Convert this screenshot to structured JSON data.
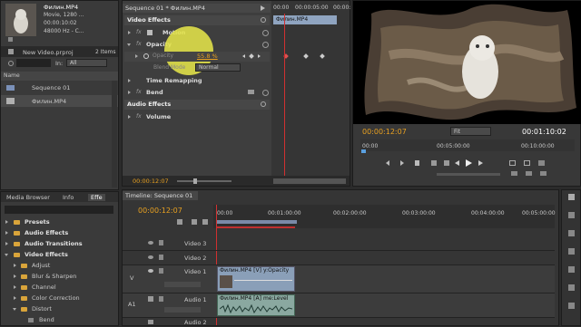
{
  "project": {
    "clip_name": "Филин.MP4",
    "clip_line2": "Movie, 1280 ...",
    "clip_line3": "00:00:10:02",
    "clip_line4": "48000 Hz - C...",
    "project_file": "New Video.prproj",
    "items_count": "2 Items",
    "in_label": "In:",
    "in_value": "All",
    "name_col": "Name",
    "items": [
      {
        "label": "Sequence 01"
      },
      {
        "label": "Филин.MP4"
      }
    ]
  },
  "effect_controls": {
    "tab_sequence": "Sequence 01 * Филин.MP4",
    "timecode_top": "00:00",
    "timecode_mid": "00:00:05:00",
    "timecode_right": "00:00:",
    "clip_label": "Филин.MP4",
    "video_effects": "Video Effects",
    "motion": "Motion",
    "opacity": "Opacity",
    "opacity_param": "Opacity",
    "opacity_value": "55.8 %",
    "blend_mode_label": "Blend Mode",
    "blend_mode_value": "Normal",
    "time_remapping": "Time Remapping",
    "bend": "Bend",
    "audio_effects": "Audio Effects",
    "volume": "Volume",
    "current_time": "00:00:12:07"
  },
  "program": {
    "current_time": "00:00:12:07",
    "fit": "Fit",
    "duration": "00:01:10:02",
    "ruler": [
      "00:00",
      "00:05:00:00",
      "00:10:00:00"
    ]
  },
  "effects_panel": {
    "tabs": [
      "Media Browser",
      "Info",
      "Effe"
    ],
    "items": [
      {
        "label": "Presets",
        "level": 0,
        "open": false
      },
      {
        "label": "Audio Effects",
        "level": 0,
        "open": false
      },
      {
        "label": "Audio Transitions",
        "level": 0,
        "open": false
      },
      {
        "label": "Video Effects",
        "level": 0,
        "open": true
      },
      {
        "label": "Adjust",
        "level": 1,
        "open": false
      },
      {
        "label": "Blur & Sharpen",
        "level": 1,
        "open": false
      },
      {
        "label": "Channel",
        "level": 1,
        "open": false
      },
      {
        "label": "Color Correction",
        "level": 1,
        "open": false
      },
      {
        "label": "Distort",
        "level": 1,
        "open": true
      },
      {
        "label": "Bend",
        "level": 2,
        "open": false
      }
    ]
  },
  "timeline": {
    "tab": "Timeline: Sequence 01",
    "current_time": "00:00:12:07",
    "ruler": [
      "00:00",
      "00:01:00:00",
      "00:02:00:00",
      "00:03:00:00",
      "00:04:00:00",
      "00:05:00:00"
    ],
    "tracks": [
      {
        "name": "Video 3"
      },
      {
        "name": "Video 2"
      },
      {
        "name": "Video 1"
      },
      {
        "name": "Audio 1"
      },
      {
        "name": "Audio 2"
      }
    ],
    "video_clip": "Филин.MP4 [V]",
    "video_clip_fx": "y:Opacity",
    "audio_clip": "Филин.MP4 [A]",
    "audio_clip_fx": "me:Level",
    "v_label": "V",
    "a1_label": "A1"
  },
  "colors": {
    "accent": "#e8a020",
    "clip_video": "#8a9fb8",
    "clip_audio": "#8aa8a0",
    "playhead": "#d03030",
    "highlight": "#e4e44a"
  }
}
